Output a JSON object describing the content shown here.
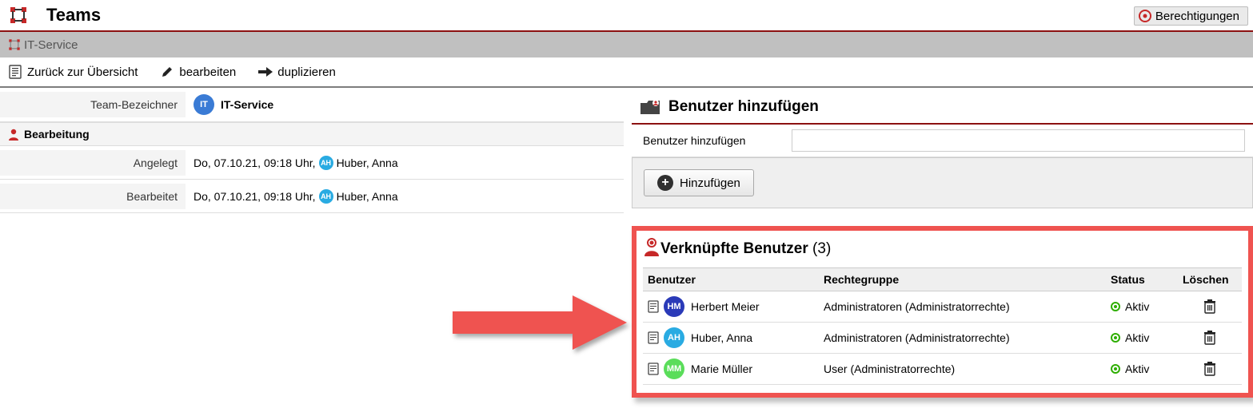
{
  "header": {
    "title": "Teams",
    "permissions_label": "Berechtigungen"
  },
  "breadcrumb": {
    "team": "IT-Service"
  },
  "toolbar": {
    "back_label": "Zurück zur Übersicht",
    "edit_label": "bearbeiten",
    "duplicate_label": "duplizieren"
  },
  "details": {
    "team_id_label": "Team-Bezeichner",
    "team_avatar_initials": "IT",
    "team_name": "IT-Service",
    "edit_section": "Bearbeitung",
    "created_label": "Angelegt",
    "edited_label": "Bearbeitet",
    "created_value": "Do, 07.10.21, 09:18 Uhr,",
    "edited_value": "Do, 07.10.21, 09:18 Uhr,",
    "editor_initials": "AH",
    "editor_name": "Huber, Anna"
  },
  "add_user": {
    "section_title": "Benutzer hinzufügen",
    "field_label": "Benutzer hinzufügen",
    "placeholder": "",
    "button_label": "Hinzufügen"
  },
  "linked": {
    "title": "Verknüpfte Benutzer",
    "count": "(3)",
    "columns": {
      "user": "Benutzer",
      "group": "Rechtegruppe",
      "status": "Status",
      "delete": "Löschen"
    },
    "status_active": "Aktiv",
    "rows": [
      {
        "initials": "HM",
        "avatar_class": "avatar-hm",
        "name": "Herbert Meier",
        "group": "Administratoren (Administratorrechte)"
      },
      {
        "initials": "AH",
        "avatar_class": "avatar-ah",
        "name": "Huber, Anna",
        "group": "Administratoren (Administratorrechte)"
      },
      {
        "initials": "MM",
        "avatar_class": "avatar-mm",
        "name": "Marie Müller",
        "group": "User (Administratorrechte)"
      }
    ]
  },
  "colors": {
    "accent": "#8c1111",
    "highlight": "#ef5350",
    "it_avatar": "#3a7bd5"
  }
}
